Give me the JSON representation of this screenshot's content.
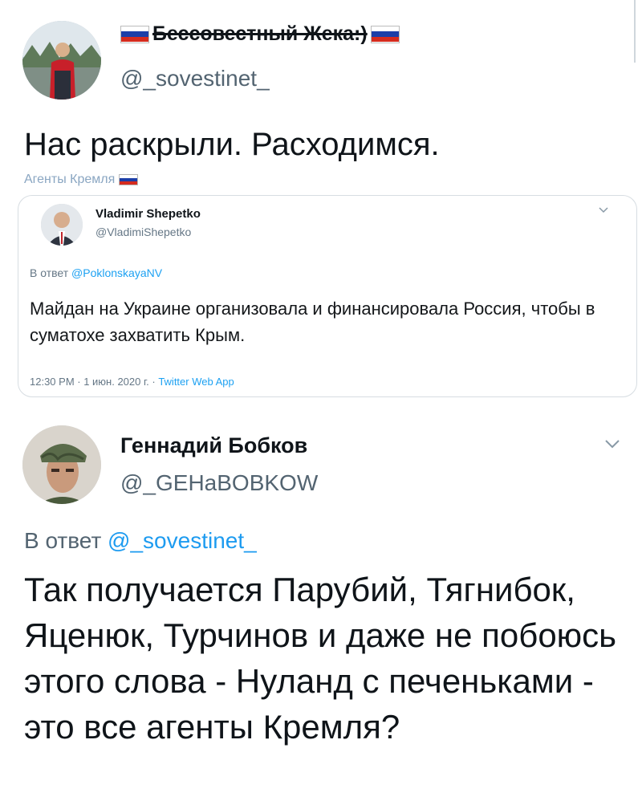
{
  "tweet1": {
    "display_name": "Бессовестный Жека:)",
    "handle": "@_sovestinet_",
    "text": "Нас раскрыли. Расходимся.",
    "tag": "Агенты Кремля"
  },
  "quoted_tweet": {
    "display_name": "Vladimir Shepetko",
    "handle": "@VladimiShepetko",
    "reply_prefix": "В ответ",
    "reply_to": "@PoklonskayaNV",
    "text": "Майдан на Украине организовала и финансировала Россия, чтобы в суматохе захватить Крым.",
    "meta": "12:30 PM · 1 июн. 2020 г. · ",
    "source": "Twitter Web App"
  },
  "tweet2": {
    "display_name": "Геннадий Бобков",
    "handle": "@_GEHaBOBKOW",
    "reply_prefix": "В ответ",
    "reply_to": "@_sovestinet_",
    "text": "Так получается Парубий, Тягнибок, Яценюк, Турчинов и даже не побоюсь этого слова - Нуланд с печеньками - это все агенты Кремля?"
  },
  "icons": {
    "flag": "russian-flag-icon",
    "chevron": "chevron-down-icon"
  },
  "colors": {
    "link": "#1d9bf0",
    "secondary_text": "#536471",
    "flag_white": "#ffffff",
    "flag_blue": "#1c3fa8",
    "flag_red": "#d52b1e"
  }
}
